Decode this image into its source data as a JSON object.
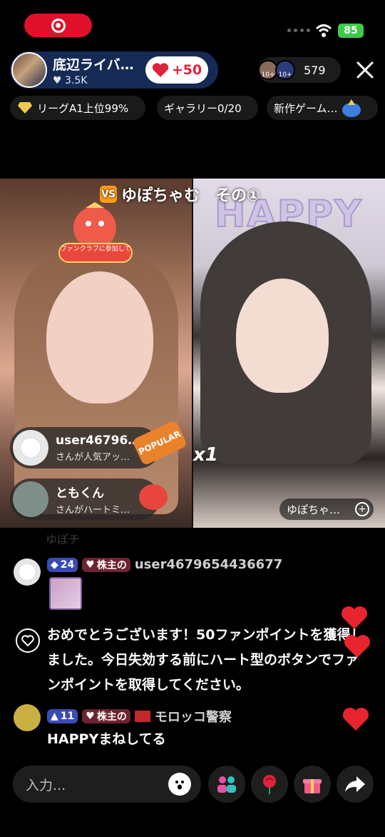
{
  "host": {
    "name": "底辺ライバ…",
    "fans": "3.5K",
    "follow_label": "+50"
  },
  "viewers": {
    "count": "579",
    "badge_a": "10+",
    "badge_b": "10+"
  },
  "chips": {
    "league": "リーグA1上位99%",
    "gallery": "ギャラリー0/20",
    "new_game": "新作ゲーム…"
  },
  "battle": {
    "title": "ゆぽちゃむ　その①",
    "vs_badge": "VS",
    "happy_sign": "HAPPY"
  },
  "fanclub_label": "ファンクラブに参加して",
  "joins": [
    {
      "name": "user46796…",
      "sub": "さんが人気アッ…"
    },
    {
      "name": "ともくん",
      "sub": "さんがハートミ…"
    }
  ],
  "popular_label": "POPULAR",
  "multiplier": "x1",
  "right_host": "ゆぽちゃ…",
  "chat": {
    "ghost": "ゆぽチ",
    "msg1": {
      "level": "24",
      "badge": "株主の",
      "user": "user4679654436677"
    },
    "notice": "おめでとうございます！50ファンポイントを獲得しました。今日失効する前にハート型のボタンでファンポイントを取得してください。",
    "msg2": {
      "level": "11",
      "badge": "株主の",
      "user": "モロッコ警察",
      "text": "HAPPYまねしてる"
    }
  },
  "input_placeholder": "入力...",
  "battery": "85",
  "colors": {
    "accent_red": "#e0233b",
    "host_bg": "#152a55"
  }
}
